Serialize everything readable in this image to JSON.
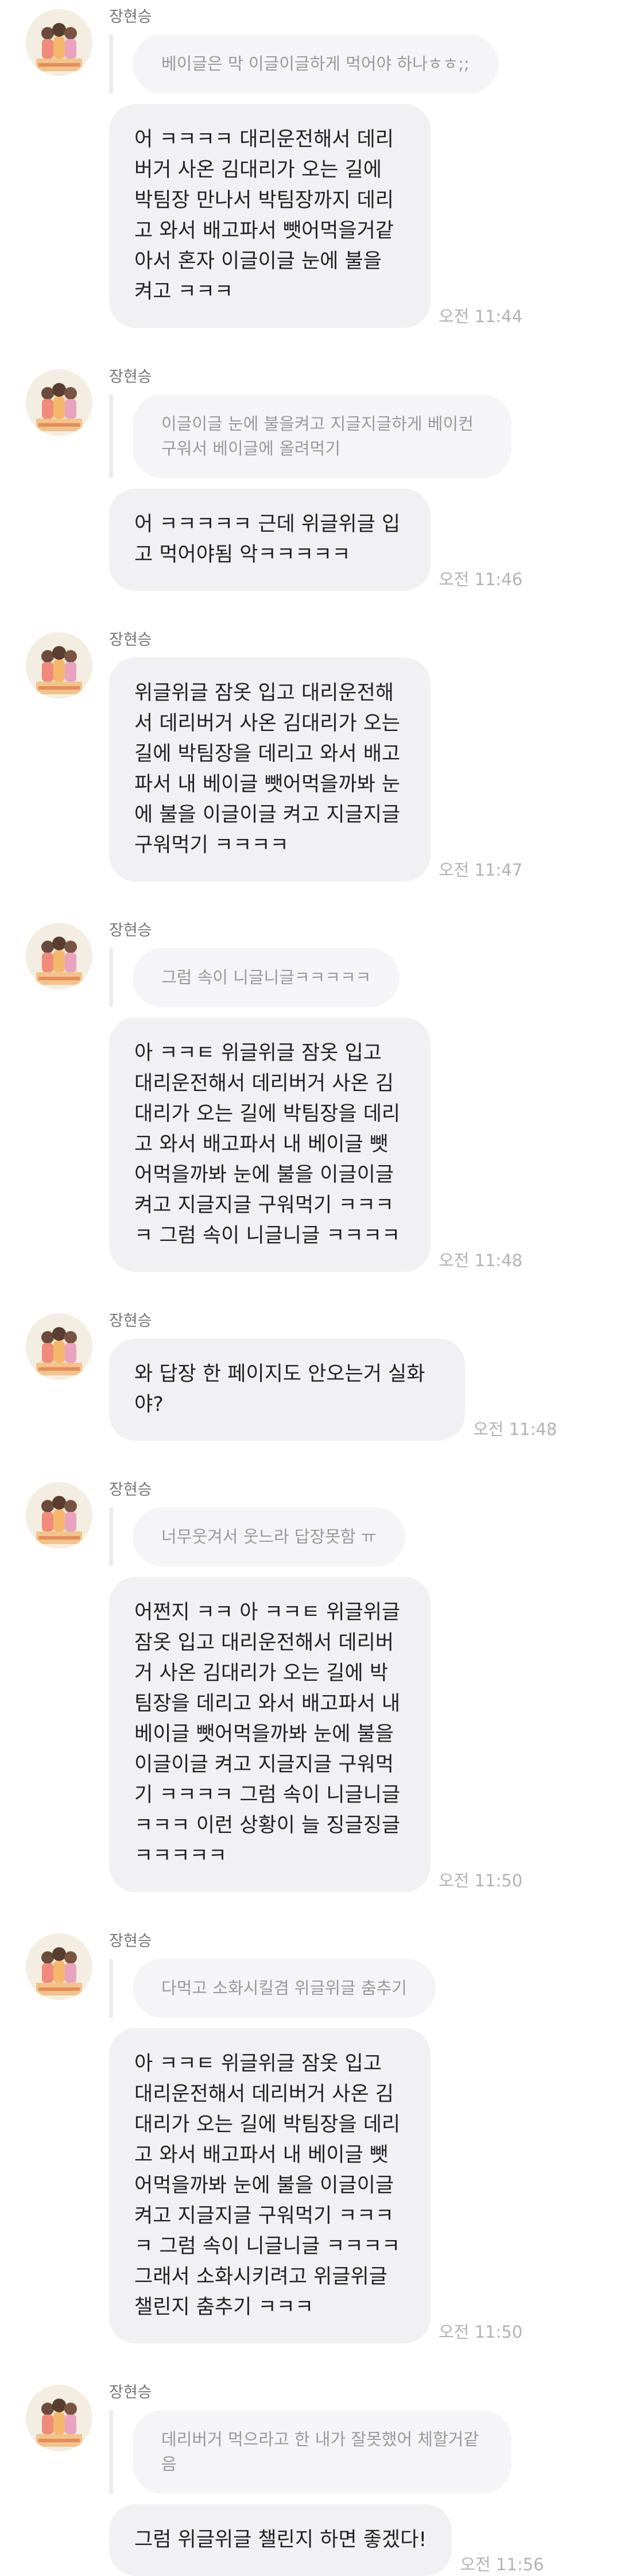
{
  "sender_name": "장현승",
  "messages": [
    {
      "reply": "베이글은 막 이글이글하게 먹어야 하나ㅎㅎ;;",
      "text": "어 ㅋㅋㅋㅋ 대리운전해서 데리버거 사온 김대리가 오는 길에 박팀장 만나서 박팀장까지 데리고 와서 배고파서 뺏어먹을거같아서 혼자 이글이글 눈에 불을 켜고 ㅋㅋㅋ",
      "time": "오전 11:44"
    },
    {
      "reply": "이글이글 눈에 불을켜고 지글지글하게 베이컨구워서 베이글에 올려먹기",
      "text": "어 ㅋㅋㅋㅋㅋ 근데 위글위글 입고 먹어야됨 악ㅋㅋㅋㅋㅋ",
      "time": "오전 11:46"
    },
    {
      "reply": "",
      "text": "위글위글 잠옷 입고 대리운전해서 데리버거 사온 김대리가 오는 길에 박팀장을 데리고 와서 배고파서 내 베이글 뺏어먹을까봐 눈에 불을 이글이글 켜고 지글지글 구워먹기 ㅋㅋㅋㅋ",
      "time": "오전 11:47"
    },
    {
      "reply": "그럼 속이 니글니글ㅋㅋㅋㅋㅋ",
      "text": "아 ㅋㅋㅌ 위글위글 잠옷 입고 대리운전해서 데리버거 사온 김대리가 오는 길에 박팀장을 데리고 와서 배고파서 내 베이글 뺏어먹을까봐 눈에 불을 이글이글 켜고 지글지글 구워먹기 ㅋㅋㅋㅋ 그럼 속이 니글니글 ㅋㅋㅋㅋ",
      "time": "오전 11:48"
    },
    {
      "reply": "",
      "text": "와 답장 한 페이지도 안오는거 실화야?",
      "time": "오전 11:48"
    },
    {
      "reply": "너무웃겨서 웃느라 답장못함 ㅠ",
      "text": "어쩐지 ㅋㅋ 아 ㅋㅋㅌ 위글위글 잠옷 입고 대리운전해서 데리버거 사온 김대리가 오는 길에 박팀장을 데리고 와서 배고파서 내 베이글 뺏어먹을까봐 눈에 불을 이글이글 켜고 지글지글 구워먹기 ㅋㅋㅋㅋ 그럼 속이 니글니글 ㅋㅋㅋ 이런 상황이 늘 징글징글ㅋㅋㅋㅋㅋ",
      "time": "오전 11:50"
    },
    {
      "reply": "다먹고 소화시킬겸 위글위글 춤추기",
      "text": "아 ㅋㅋㅌ 위글위글 잠옷 입고 대리운전해서 데리버거 사온 김대리가 오는 길에 박팀장을 데리고 와서 배고파서 내 베이글 뺏어먹을까봐 눈에 불을 이글이글 켜고 지글지글 구워먹기 ㅋㅋㅋㅋ 그럼 속이 니글니글 ㅋㅋㅋㅋ 그래서 소화시키려고 위글위글 챌린지 춤추기 ㅋㅋㅋ",
      "time": "오전 11:50"
    },
    {
      "reply": "데리버거 먹으라고 한 내가 잘못했어 체할거같음",
      "text": "그럼 위글위글 챌린지 하면 좋겠다!",
      "time": "오전 11:56"
    }
  ],
  "colors": {
    "bubble_bg": "#f1f1f3",
    "reply_bg": "#f5f5f7",
    "timestamp": "#b3b3b3"
  }
}
